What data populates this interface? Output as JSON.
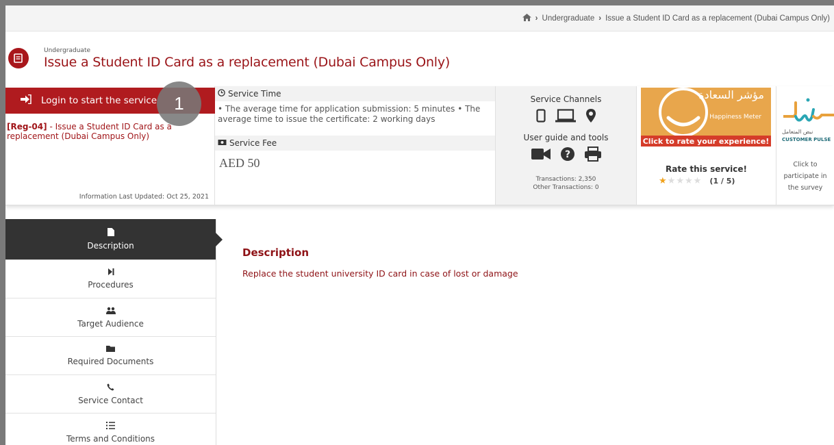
{
  "breadcrumb": {
    "home_icon": "home-icon",
    "items": [
      "Undergraduate",
      "Issue a Student ID Card as a replacement (Dubai Campus Only)"
    ]
  },
  "header": {
    "category": "Undergraduate",
    "title": "Issue a Student ID Card as a replacement (Dubai Campus Only)",
    "icon": "document-icon",
    "accent": "#a8161b"
  },
  "login": {
    "label": "Login to start the service",
    "code": "[Reg-04]",
    "service_name": " - Issue a Student ID Card as a replacement (Dubai Campus Only)",
    "last_updated": "Information Last Updated: Oct 25, 2021"
  },
  "callout": {
    "number": "1"
  },
  "service_time": {
    "label": "Service Time",
    "text": "• The average time for application submission: 5 minutes • The average time to issue the certificate: 2 working days"
  },
  "service_fee": {
    "label": "Service Fee",
    "value": "AED 50"
  },
  "channels": {
    "label": "Service Channels",
    "icons": [
      "mobile-icon",
      "laptop-icon",
      "location-pin-icon"
    ],
    "guide_label": "User guide and tools",
    "guide_icons": [
      "video-icon",
      "question-icon",
      "print-icon"
    ],
    "transactions": "Transactions: 2,350",
    "other_transactions": "Other Transactions: 0"
  },
  "happiness": {
    "arabic": "مؤشر السعادة",
    "english": "Happiness Meter",
    "cta": "Click to rate your experience!"
  },
  "rating": {
    "label": "Rate this service!",
    "value": 1,
    "max": 5,
    "count_text": "(1 / 5)"
  },
  "pulse": {
    "arabic": "نبض المتعامل",
    "english": "CUSTOMER PULSE",
    "cta_line1": "Click to",
    "cta_line2": "participate in",
    "cta_line3": "the survey"
  },
  "tabs": [
    {
      "label": "Description",
      "icon": "file-icon",
      "active": true
    },
    {
      "label": "Procedures",
      "icon": "step-forward-icon",
      "active": false
    },
    {
      "label": "Target Audience",
      "icon": "users-icon",
      "active": false
    },
    {
      "label": "Required Documents",
      "icon": "folder-icon",
      "active": false
    },
    {
      "label": "Service Contact",
      "icon": "phone-icon",
      "active": false
    },
    {
      "label": "Terms and Conditions",
      "icon": "list-icon",
      "active": false
    }
  ],
  "content": {
    "heading": "Description",
    "text": "Replace the student university ID card in case of lost or damage"
  }
}
